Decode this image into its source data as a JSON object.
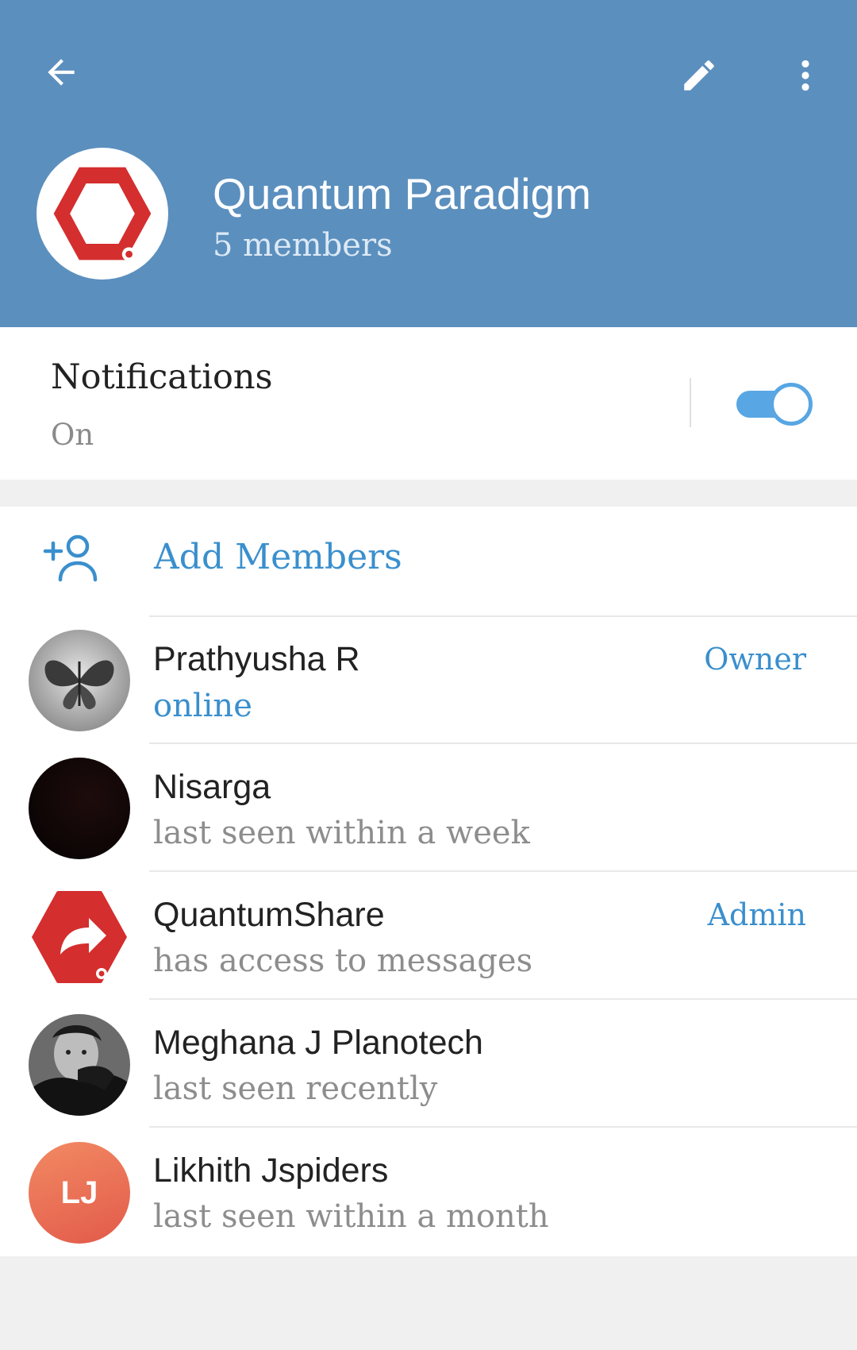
{
  "header": {
    "title": "Quantum Paradigm",
    "subtitle": "5 members",
    "color": "#5b8fbe"
  },
  "notifications": {
    "label": "Notifications",
    "state": "On",
    "enabled": true
  },
  "add_members": {
    "label": "Add Members"
  },
  "members": [
    {
      "name": "Prathyusha R",
      "status": "online",
      "role": "Owner",
      "avatar": "butterfly-photo"
    },
    {
      "name": "Nisarga",
      "status": "last seen within a week",
      "role": "",
      "avatar": "dark-photo"
    },
    {
      "name": "QuantumShare",
      "status": "has access to messages",
      "role": "Admin",
      "avatar": "share-bot-logo"
    },
    {
      "name": "Meghana J Planotech",
      "status": "last seen recently",
      "role": "",
      "avatar": "portrait-photo"
    },
    {
      "name": "Likhith Jspiders",
      "status": "last seen within a month",
      "role": "",
      "avatar": "initials",
      "initials": "LJ"
    }
  ],
  "accent_color": "#3a8fcd"
}
